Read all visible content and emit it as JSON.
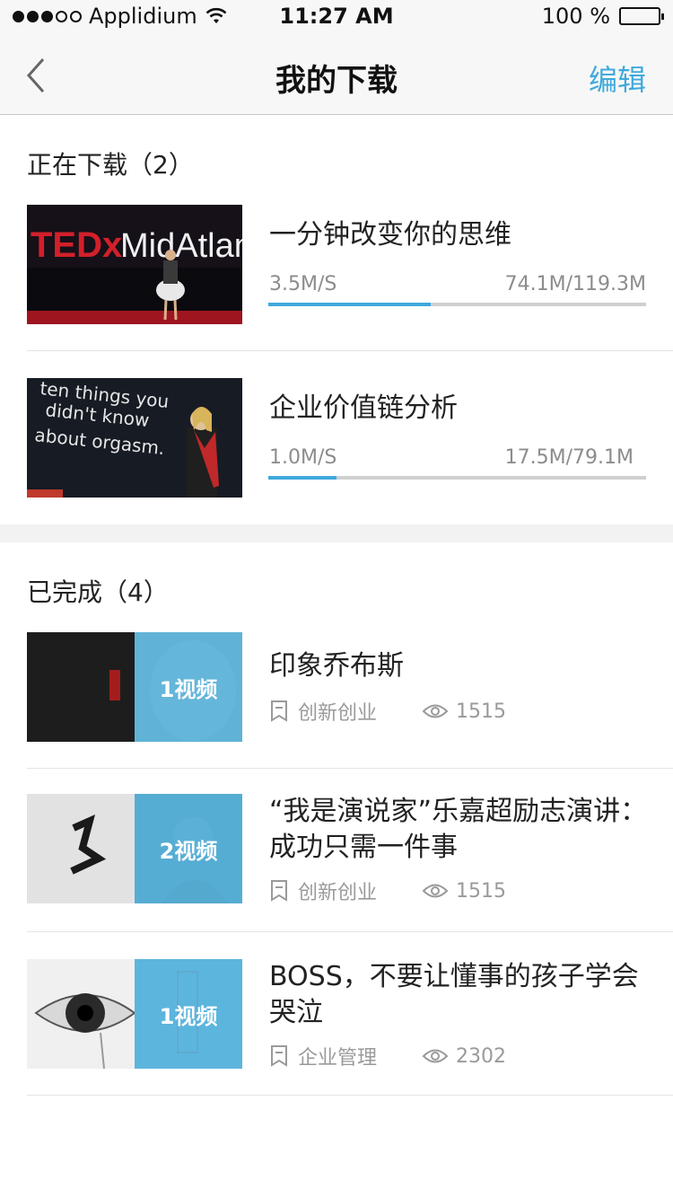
{
  "status_bar": {
    "carrier": "Applidium",
    "time": "11:27 AM",
    "battery": "100 %",
    "signal_bars_filled": 3,
    "signal_bars_total": 5
  },
  "nav": {
    "title": "我的下载",
    "edit_label": "编辑",
    "accent_color": "#3fa9dc"
  },
  "downloading": {
    "section_title": "正在下载（2）",
    "items": [
      {
        "title": "一分钟改变你的思维",
        "speed": "3.5M/S",
        "size": "74.1M/119.3M",
        "progress": 0.43
      },
      {
        "title": "企业价值链分析",
        "speed": "1.0M/S",
        "size": "17.5M/79.1M",
        "progress": 0.18
      }
    ]
  },
  "completed": {
    "section_title": "已完成（4）",
    "items": [
      {
        "title": "印象乔布斯",
        "category": "创新创业",
        "views": "1515",
        "badge": "1视频"
      },
      {
        "title": "“我是演说家”乐嘉超励志演讲：成功只需一件事",
        "category": "创新创业",
        "views": "1515",
        "badge": "2视频"
      },
      {
        "title": "BOSS，不要让懂事的孩子学会哭泣",
        "category": "企业管理",
        "views": "2302",
        "badge": "1视频"
      }
    ]
  },
  "icons": [
    "back-chevron-icon",
    "wifi-icon",
    "battery-icon",
    "bookmark-icon",
    "eye-icon"
  ]
}
